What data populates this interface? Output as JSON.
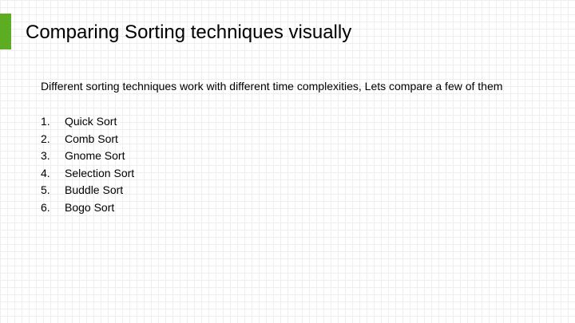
{
  "slide": {
    "accent_color": "#5cad22",
    "title": "Comparing Sorting techniques visually",
    "intro": "Different sorting techniques work with different time complexities, Lets compare a few of them",
    "items": [
      {
        "number": "1.",
        "label": "Quick Sort"
      },
      {
        "number": "2.",
        "label": "Comb Sort"
      },
      {
        "number": "3.",
        "label": "Gnome Sort"
      },
      {
        "number": "4.",
        "label": "Selection Sort"
      },
      {
        "number": "5.",
        "label": "Buddle Sort"
      },
      {
        "number": "6.",
        "label": "Bogo Sort"
      }
    ]
  }
}
